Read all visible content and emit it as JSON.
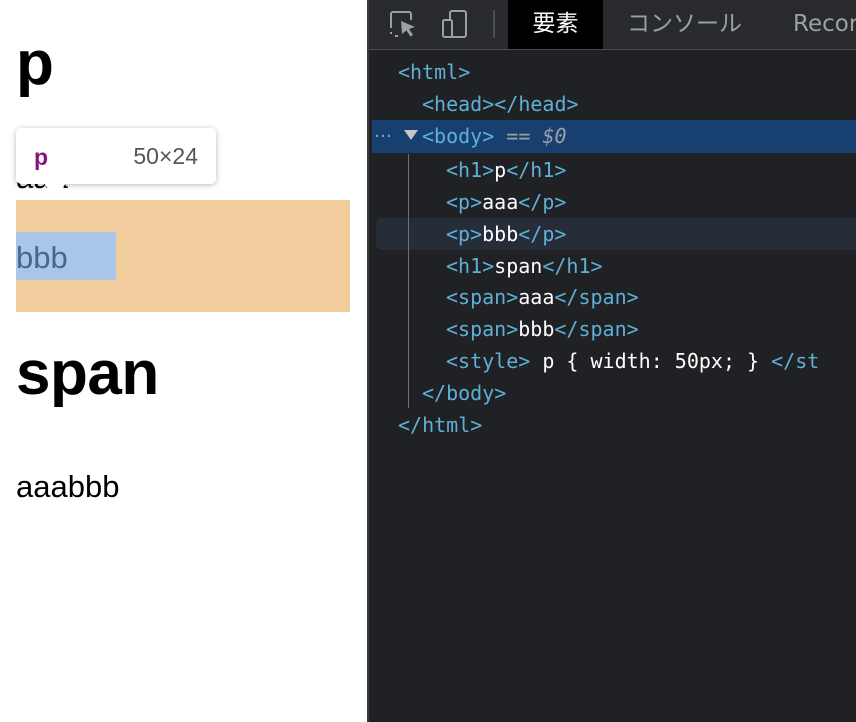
{
  "page": {
    "h1_first": "p",
    "p_first": "aaa",
    "p_second": "bbb",
    "h1_second": "span",
    "span_first": "aaa",
    "span_second": "bbb",
    "highlight_colors": {
      "margin": "#f1cd9d",
      "content": "#a9c5e7"
    }
  },
  "tooltip": {
    "tag": "p",
    "size": "50×24"
  },
  "devtools": {
    "toolbar": {
      "inspect_icon": "inspect-element-icon",
      "device_icon": "device-toolbar-icon",
      "tabs": [
        "要素",
        "コンソール",
        "Recor"
      ],
      "active_tab": "要素"
    },
    "dom": {
      "html_open": "<html>",
      "head": "<head></head>",
      "body_open": "<body>",
      "body_eq": "==",
      "body_ref": "$0",
      "h1_open": "<h1>",
      "h1_close": "</h1>",
      "p_open": "<p>",
      "p_close": "</p>",
      "span_open": "<span>",
      "span_close": "</span>",
      "h1_p_text": "p",
      "p_aaa_text": "aaa",
      "p_bbb_text": "bbb",
      "h1_span_text": "span",
      "span_aaa_text": "aaa",
      "span_bbb_text": "bbb",
      "style_open": "<style>",
      "style_text": " p { width: 50px; } ",
      "style_close": "</st",
      "body_close": "</body>",
      "html_close": "</html>",
      "ellipsis": "…"
    }
  }
}
